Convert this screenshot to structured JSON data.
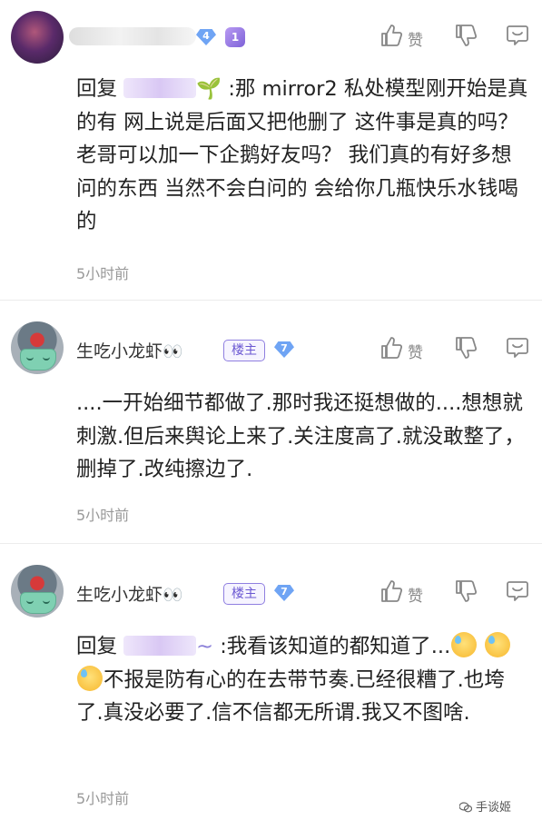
{
  "comments": [
    {
      "username_blurred": true,
      "badges": {
        "level": "4",
        "rank": "1"
      },
      "actions": {
        "like_label": "赞"
      },
      "reply_prefix": "回复",
      "reply_suffix": "🌱",
      "text": ":那 mirror2 私处模型刚开始是真的有 网上说是后面又把他删了 这件事是真的吗？ 老哥可以加一下企鹅好友吗？ 我们真的有好多想问的东西 当然不会白问的 会给你几瓶快乐水钱喝的",
      "time": "5小时前"
    },
    {
      "username": "生吃小龙虾",
      "username_emoji": "👀",
      "owner_tag": "楼主",
      "level": "7",
      "actions": {
        "like_label": "赞"
      },
      "text": "....一开始细节都做了.那时我还挺想做的....想想就刺激.但后来舆论上来了.关注度高了.就没敢整了，删掉了.改纯擦边了.",
      "time": "5小时前"
    },
    {
      "username": "生吃小龙虾",
      "username_emoji": "👀",
      "owner_tag": "楼主",
      "level": "7",
      "actions": {
        "like_label": "赞"
      },
      "reply_prefix": "回复",
      "reply_suffix": "~",
      "text_part1": ":我看该知道的都知道了...",
      "text_part2": "不报是防有心的在去带节奏.已经很糟了.也垮了.真没必要了.信不信都无所谓.我又不图啥.",
      "time": "5小时前"
    }
  ],
  "watermark": "手谈姬"
}
